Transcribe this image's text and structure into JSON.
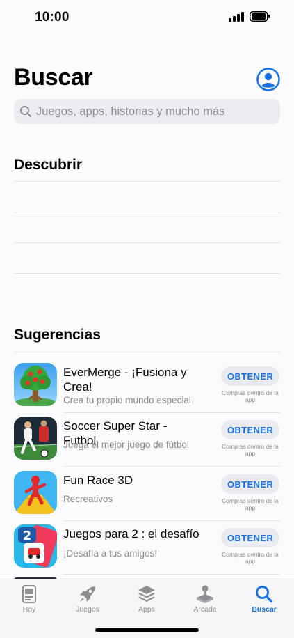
{
  "status": {
    "time": "10:00"
  },
  "header": {
    "title": "Buscar"
  },
  "search": {
    "placeholder": "Juegos, apps, historias y mucho más"
  },
  "sections": {
    "discover": "Descubrir",
    "suggestions": "Sugerencias"
  },
  "suggestions": [
    {
      "name": "EverMerge - ¡Fusiona y Crea!",
      "subtitle": "Crea tu propio mundo especial",
      "button": "OBTENER",
      "note": "Compras dentro de la app"
    },
    {
      "name": "Soccer Super Star - Futbol",
      "subtitle": "Juega el mejor juego de fútbol",
      "button": "OBTENER",
      "note": "Compras dentro de la app"
    },
    {
      "name": "Fun Race 3D",
      "subtitle": "Recreativos",
      "button": "OBTENER",
      "note": "Compras dentro de la app"
    },
    {
      "name": "Juegos para 2 : el desafío",
      "subtitle": "¡Desafía a tus amigos!",
      "button": "OBTENER",
      "note": "Compras dentro de la app"
    }
  ],
  "tabs": [
    {
      "label": "Hoy",
      "icon": "today-icon",
      "active": false
    },
    {
      "label": "Juegos",
      "icon": "rocket-icon",
      "active": false
    },
    {
      "label": "Apps",
      "icon": "apps-stack-icon",
      "active": false
    },
    {
      "label": "Arcade",
      "icon": "joystick-icon",
      "active": false
    },
    {
      "label": "Buscar",
      "icon": "search-icon",
      "active": true
    }
  ],
  "colors": {
    "accent": "#1a73e8",
    "background": "#fbfbfd"
  }
}
